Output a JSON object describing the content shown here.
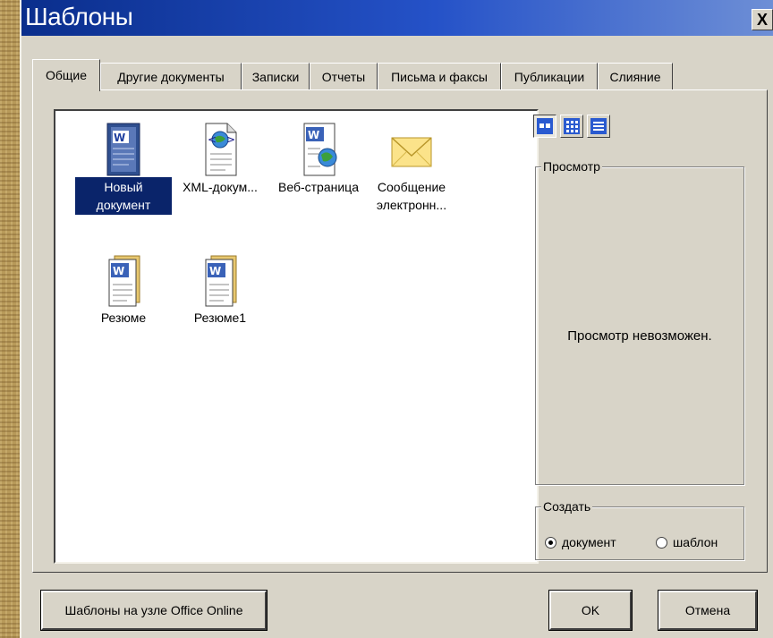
{
  "window": {
    "title": "Шаблоны",
    "close_label": "X"
  },
  "tabs": [
    {
      "label": "Общие",
      "active": true
    },
    {
      "label": "Другие документы"
    },
    {
      "label": "Записки"
    },
    {
      "label": "Отчеты"
    },
    {
      "label": "Письма и факсы"
    },
    {
      "label": "Публикации"
    },
    {
      "label": "Слияние"
    }
  ],
  "files": [
    {
      "label": "Новый документ",
      "icon": "word-document-icon",
      "selected": true
    },
    {
      "label": "XML-докум...",
      "icon": "xml-document-icon"
    },
    {
      "label": "Веб-страница",
      "icon": "web-page-icon"
    },
    {
      "label": "Сообщение электронн...",
      "icon": "email-envelope-icon"
    },
    {
      "label": "Резюме",
      "icon": "word-template-icon"
    },
    {
      "label": "Резюме1",
      "icon": "word-template-icon"
    }
  ],
  "view_buttons": [
    {
      "name": "large-icons-view",
      "active": true
    },
    {
      "name": "list-view"
    },
    {
      "name": "details-view"
    }
  ],
  "preview": {
    "legend": "Просмотр",
    "message": "Просмотр невозможен."
  },
  "create": {
    "legend": "Создать",
    "options": [
      {
        "label": "документ",
        "checked": true
      },
      {
        "label": "шаблон",
        "checked": false
      }
    ]
  },
  "buttons": {
    "online_templates": "Шаблоны на узле Office Online",
    "ok": "OK",
    "cancel": "Отмена"
  },
  "colors": {
    "title_bar": "#0a2e8c",
    "dialog_face": "#d8d4c8",
    "selection": "#0a246a"
  }
}
